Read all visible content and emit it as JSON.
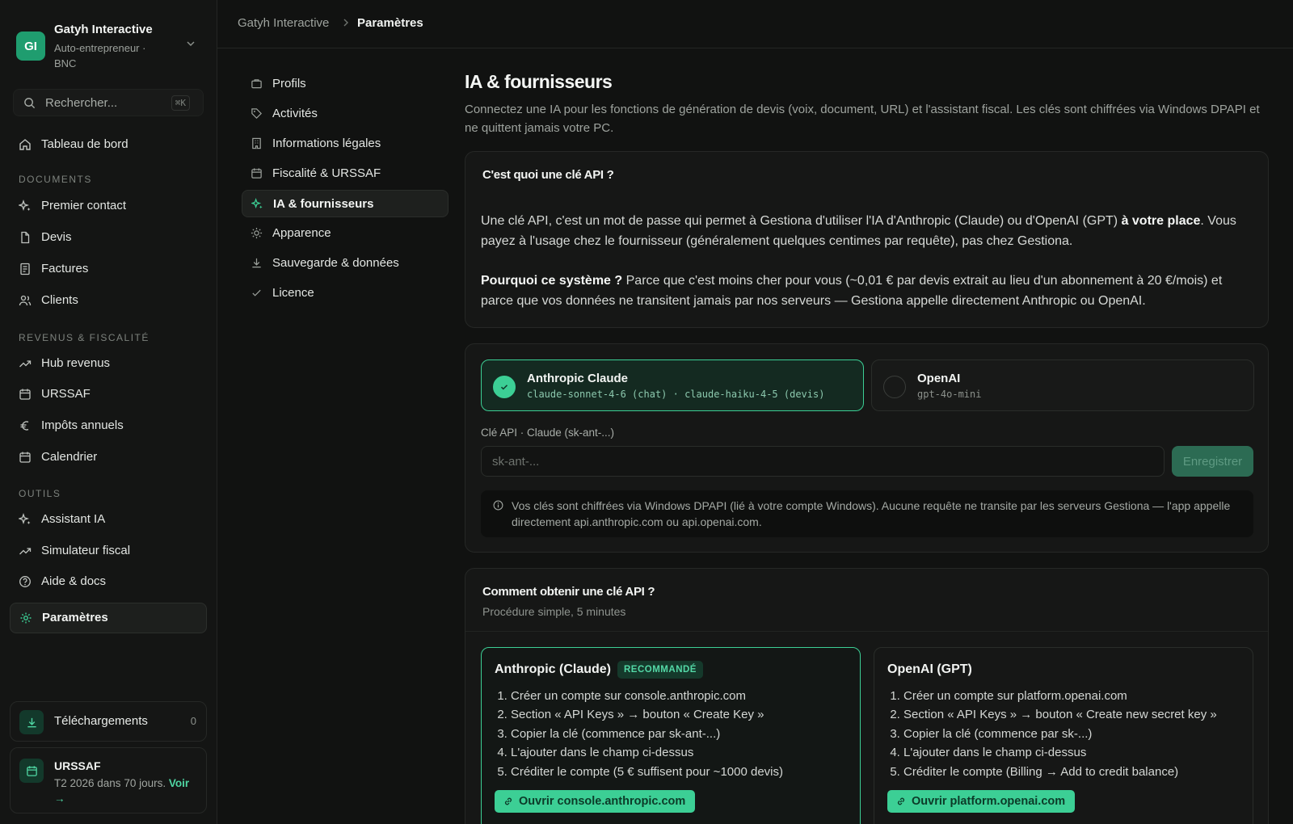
{
  "workspace": {
    "initials": "GI",
    "name": "Gatyh Interactive",
    "subtitle": "Auto-entrepreneur · BNC"
  },
  "search": {
    "placeholder": "Rechercher...",
    "shortcut": "⌘K"
  },
  "sidebar": {
    "dashboard": "Tableau de bord",
    "sections": {
      "documents": "DOCUMENTS",
      "revenus": "REVENUS & FISCALITÉ",
      "outils": "OUTILS"
    },
    "documents": [
      "Premier contact",
      "Devis",
      "Factures",
      "Clients"
    ],
    "revenus": [
      "Hub revenus",
      "URSSAF",
      "Impôts annuels",
      "Calendrier"
    ],
    "outils": [
      "Assistant IA",
      "Simulateur fiscal",
      "Aide & docs",
      "Paramètres"
    ],
    "downloads": {
      "label": "Téléchargements",
      "count": "0"
    },
    "urssaf_card": {
      "title": "URSSAF",
      "text": "T2 2026 dans 70 jours.",
      "link": "Voir →"
    }
  },
  "breadcrumb": {
    "root": "Gatyh Interactive",
    "current": "Paramètres"
  },
  "settings_nav": [
    "Profils",
    "Activités",
    "Informations légales",
    "Fiscalité & URSSAF",
    "IA & fournisseurs",
    "Apparence",
    "Sauvegarde & données",
    "Licence"
  ],
  "page": {
    "title": "IA & fournisseurs",
    "lead": "Connectez une IA pour les fonctions de génération de devis (voix, document, URL) et l'assistant fiscal. Les clés sont chiffrées via Windows DPAPI et ne quittent jamais votre PC."
  },
  "explain": {
    "title": "C'est quoi une clé API ?",
    "p1_a": "Une clé API, c'est un mot de passe qui permet à Gestiona d'utiliser l'IA d'Anthropic (Claude) ou d'OpenAI (GPT) ",
    "p1_strong": "à votre place",
    "p1_b": ". Vous payez à l'usage chez le fournisseur (généralement quelques centimes par requête), pas chez Gestiona.",
    "p2_strong": "Pourquoi ce système ?",
    "p2_b": " Parce que c'est moins cher pour vous (~0,01 € par devis extrait au lieu d'un abonnement à 20 €/mois) et parce que vos données ne transitent jamais par nos serveurs — Gestiona appelle directement Anthropic ou OpenAI."
  },
  "providers": [
    {
      "name": "Anthropic Claude",
      "model": "claude-sonnet-4-6 (chat) · claude-haiku-4-5 (devis)",
      "selected": true
    },
    {
      "name": "OpenAI",
      "model": "gpt-4o-mini",
      "selected": false
    }
  ],
  "api_key": {
    "label": "Clé API · Claude (sk-ant-...)",
    "placeholder": "sk-ant-...",
    "value": "",
    "save": "Enregistrer"
  },
  "security_note": "Vos clés sont chiffrées via Windows DPAPI (lié à votre compte Windows). Aucune requête ne transite par les serveurs Gestiona — l'app appelle directement api.anthropic.com ou api.openai.com.",
  "howto": {
    "title": "Comment obtenir une clé API ?",
    "subtitle": "Procédure simple, 5 minutes",
    "anthropic": {
      "title": "Anthropic (Claude)",
      "badge": "RECOMMANDÉ",
      "steps": [
        "Créer un compte sur console.anthropic.com",
        "Section « API Keys » → bouton « Create Key »",
        "Copier la clé (commence par sk-ant-...)",
        "L'ajouter dans le champ ci-dessus",
        "Créditer le compte (5 € suffisent pour ~1000 devis)"
      ],
      "button": "Ouvrir console.anthropic.com"
    },
    "openai": {
      "title": "OpenAI (GPT)",
      "steps": [
        "Créer un compte sur platform.openai.com",
        "Section « API Keys » → bouton « Create new secret key »",
        "Copier la clé (commence par sk-...)",
        "L'ajouter dans le champ ci-dessus",
        "Créditer le compte (Billing → Add to credit balance)"
      ],
      "button": "Ouvrir platform.openai.com"
    }
  },
  "colors": {
    "accent": "#3ccf95",
    "background": "#111211",
    "card": "#161716"
  }
}
